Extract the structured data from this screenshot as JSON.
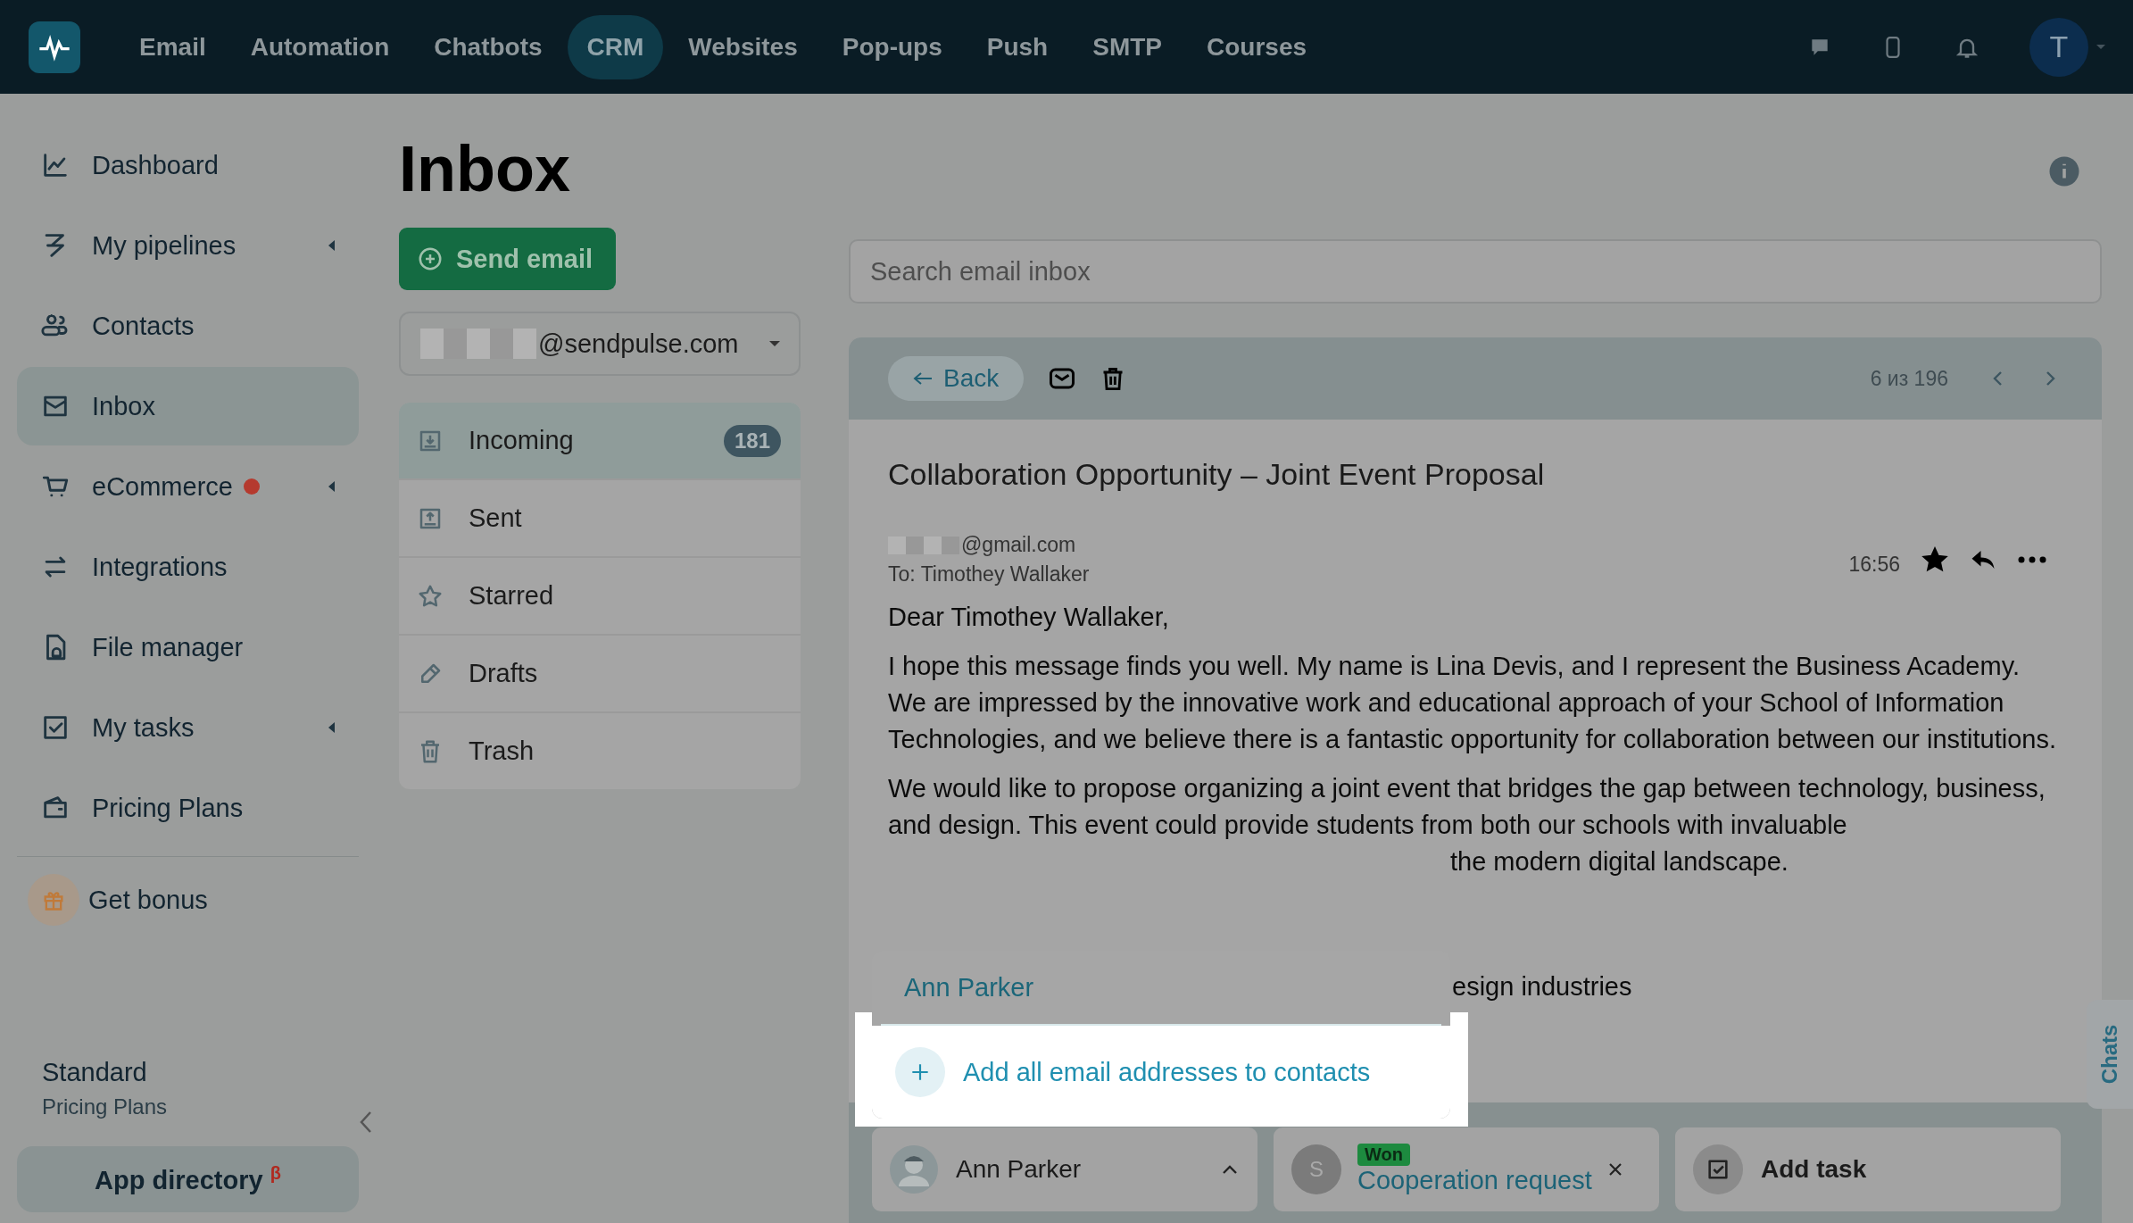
{
  "nav": {
    "items": [
      {
        "label": "Email",
        "selected": false
      },
      {
        "label": "Automation",
        "selected": false
      },
      {
        "label": "Chatbots",
        "selected": false
      },
      {
        "label": "CRM",
        "selected": true
      },
      {
        "label": "Websites",
        "selected": false
      },
      {
        "label": "Pop-ups",
        "selected": false
      },
      {
        "label": "Push",
        "selected": false
      },
      {
        "label": "SMTP",
        "selected": false
      },
      {
        "label": "Courses",
        "selected": false
      }
    ],
    "avatar": "T"
  },
  "sidebar": {
    "items": [
      {
        "label": "Dashboard",
        "selected": false,
        "has_submenu": false,
        "dot": false
      },
      {
        "label": "My pipelines",
        "selected": false,
        "has_submenu": true,
        "dot": false
      },
      {
        "label": "Contacts",
        "selected": false,
        "has_submenu": false,
        "dot": false
      },
      {
        "label": "Inbox",
        "selected": true,
        "has_submenu": false,
        "dot": false
      },
      {
        "label": "eCommerce",
        "selected": false,
        "has_submenu": true,
        "dot": true
      },
      {
        "label": "Integrations",
        "selected": false,
        "has_submenu": false,
        "dot": false
      },
      {
        "label": "File manager",
        "selected": false,
        "has_submenu": false,
        "dot": false
      },
      {
        "label": "My tasks",
        "selected": false,
        "has_submenu": true,
        "dot": false
      },
      {
        "label": "Pricing Plans",
        "selected": false,
        "has_submenu": false,
        "dot": false
      }
    ],
    "bonus": "Get bonus",
    "plan": "Standard",
    "plan_caption": "Pricing Plans",
    "app_directory": "App directory $^{β}$"
  },
  "title": "Inbox",
  "send_button": "Send email",
  "mailbox": "@sendpulse.com",
  "folders": [
    {
      "label": "Incoming",
      "count": "181",
      "selected": true
    },
    {
      "label": "Sent",
      "selected": false
    },
    {
      "label": "Starred",
      "selected": false
    },
    {
      "label": "Drafts",
      "selected": false
    },
    {
      "label": "Trash",
      "selected": false
    }
  ],
  "search": {
    "placeholder": "Search email inbox"
  },
  "message": {
    "back": "Back",
    "position": "6 из 196",
    "subject": "Collaboration Opportunity – Joint Event Proposal",
    "from": "@gmail.com",
    "to": "To: Timothey Wallaker",
    "time": "16:56",
    "starred": true,
    "greeting": "Dear Timothey Wallaker,",
    "paragraphs": [
      "I hope this message finds you well. My name is Lina Devis, and I represent the Business Academy. We are impressed by the innovative work and educational approach of your School of Information Technologies, and we believe there is a fantastic opportunity for collaboration between our institutions.",
      "We would like to propose organizing a joint event that bridges the gap between technology, business, and design. This event could provide students from both our schools with invaluable"
    ],
    "fragments": [
      "the modern digital landscape.",
      "esign industries"
    ]
  },
  "popup": {
    "contact": "Ann Parker",
    "action": "Add all email addresses to contacts"
  },
  "footer": {
    "contact": "Ann Parker",
    "deal_status": "Won",
    "deal_initial": "S",
    "deal": "Cooperation request",
    "task": "Add task"
  },
  "chats_tab": "Chats"
}
